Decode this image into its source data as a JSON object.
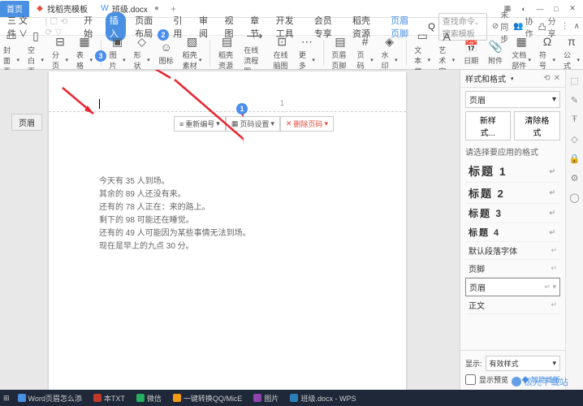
{
  "titlebar": {
    "tabs": [
      {
        "label": "首页",
        "type": "home"
      },
      {
        "label": "找稻壳模板",
        "type": "tpl"
      },
      {
        "label": "班级.docx",
        "type": "doc"
      }
    ]
  },
  "menubar": {
    "items": [
      "三 文件 ∨",
      "开始",
      "插入",
      "页面布局",
      "引用",
      "审阅",
      "视图",
      "章节",
      "开发工具",
      "会员专享",
      "稻壳资源"
    ],
    "active_index": 2,
    "highlight_index": 11,
    "highlight_label": "页眉页脚",
    "search_icon": "Q",
    "search_placeholder": "查找命令、搜索模板",
    "right": {
      "unsync": "未同步",
      "coop": "协作",
      "share": "分享"
    }
  },
  "toolbar": {
    "items": [
      {
        "label": "封面页",
        "dd": true
      },
      {
        "label": "空白页",
        "dd": true
      },
      {
        "label": "分页",
        "dd": true
      },
      {
        "label": "表格",
        "dd": true
      },
      {
        "label": "图片",
        "dd": true
      },
      {
        "label": "形状",
        "dd": true
      },
      {
        "label": "图标",
        "dd": false
      },
      {
        "label": "稻壳素材",
        "dd": true
      },
      {
        "label": "稻壳资源",
        "dd": false
      },
      {
        "label": "在线流程图",
        "dd": false
      },
      {
        "label": "在线脑图",
        "dd": false
      },
      {
        "label": "更多",
        "dd": true
      },
      {
        "label": "页眉页脚",
        "dd": false
      },
      {
        "label": "页码",
        "dd": true
      },
      {
        "label": "水印",
        "dd": true
      },
      {
        "label": "文本框",
        "dd": true
      },
      {
        "label": "艺术字",
        "dd": true
      },
      {
        "label": "日期",
        "dd": false
      },
      {
        "label": "附件",
        "dd": false
      },
      {
        "label": "文档部件",
        "dd": true
      },
      {
        "label": "符号",
        "dd": true
      },
      {
        "label": "公式",
        "dd": true
      }
    ]
  },
  "document": {
    "header_label": "页眉",
    "page_number": "1",
    "header_tools": {
      "renumber": "重新编号",
      "settings": "页码设置",
      "delete": "删除页码"
    },
    "body_lines": [
      "今天有 35 人到场。",
      "其余的 89 人还没有来。",
      "还有的 78 人正在：来的路上。",
      "剩下的 98 可能还在睡觉。",
      "还有的 49 人可能因为某些事情无法到场。",
      "现在是早上的九点 30 分。"
    ]
  },
  "badges": {
    "b1": "1",
    "b2": "2",
    "b3": "3"
  },
  "panel": {
    "title": "样式和格式",
    "current": "页眉",
    "new_style": "新样式...",
    "clear": "清除格式",
    "hint": "请选择要应用的格式",
    "styles": [
      {
        "label": "标题 1",
        "cls": "h1"
      },
      {
        "label": "标题 2",
        "cls": "h2"
      },
      {
        "label": "标题 3",
        "cls": "h3"
      },
      {
        "label": "标题 4",
        "cls": "h4"
      },
      {
        "label": "默认段落字体",
        "cls": ""
      },
      {
        "label": "页脚",
        "cls": ""
      },
      {
        "label": "页眉",
        "cls": "",
        "selected": true
      },
      {
        "label": "正文",
        "cls": ""
      }
    ],
    "show_label": "显示:",
    "show_value": "有效样式",
    "preview": "显示预览",
    "smart": "智能排版"
  },
  "taskbar": {
    "items": [
      "Word页眉怎么添",
      "本TXT",
      "微信",
      "一键转换QQ/MicE",
      "图片",
      "班级.docx - WPS"
    ]
  },
  "watermark": "极光下载站"
}
